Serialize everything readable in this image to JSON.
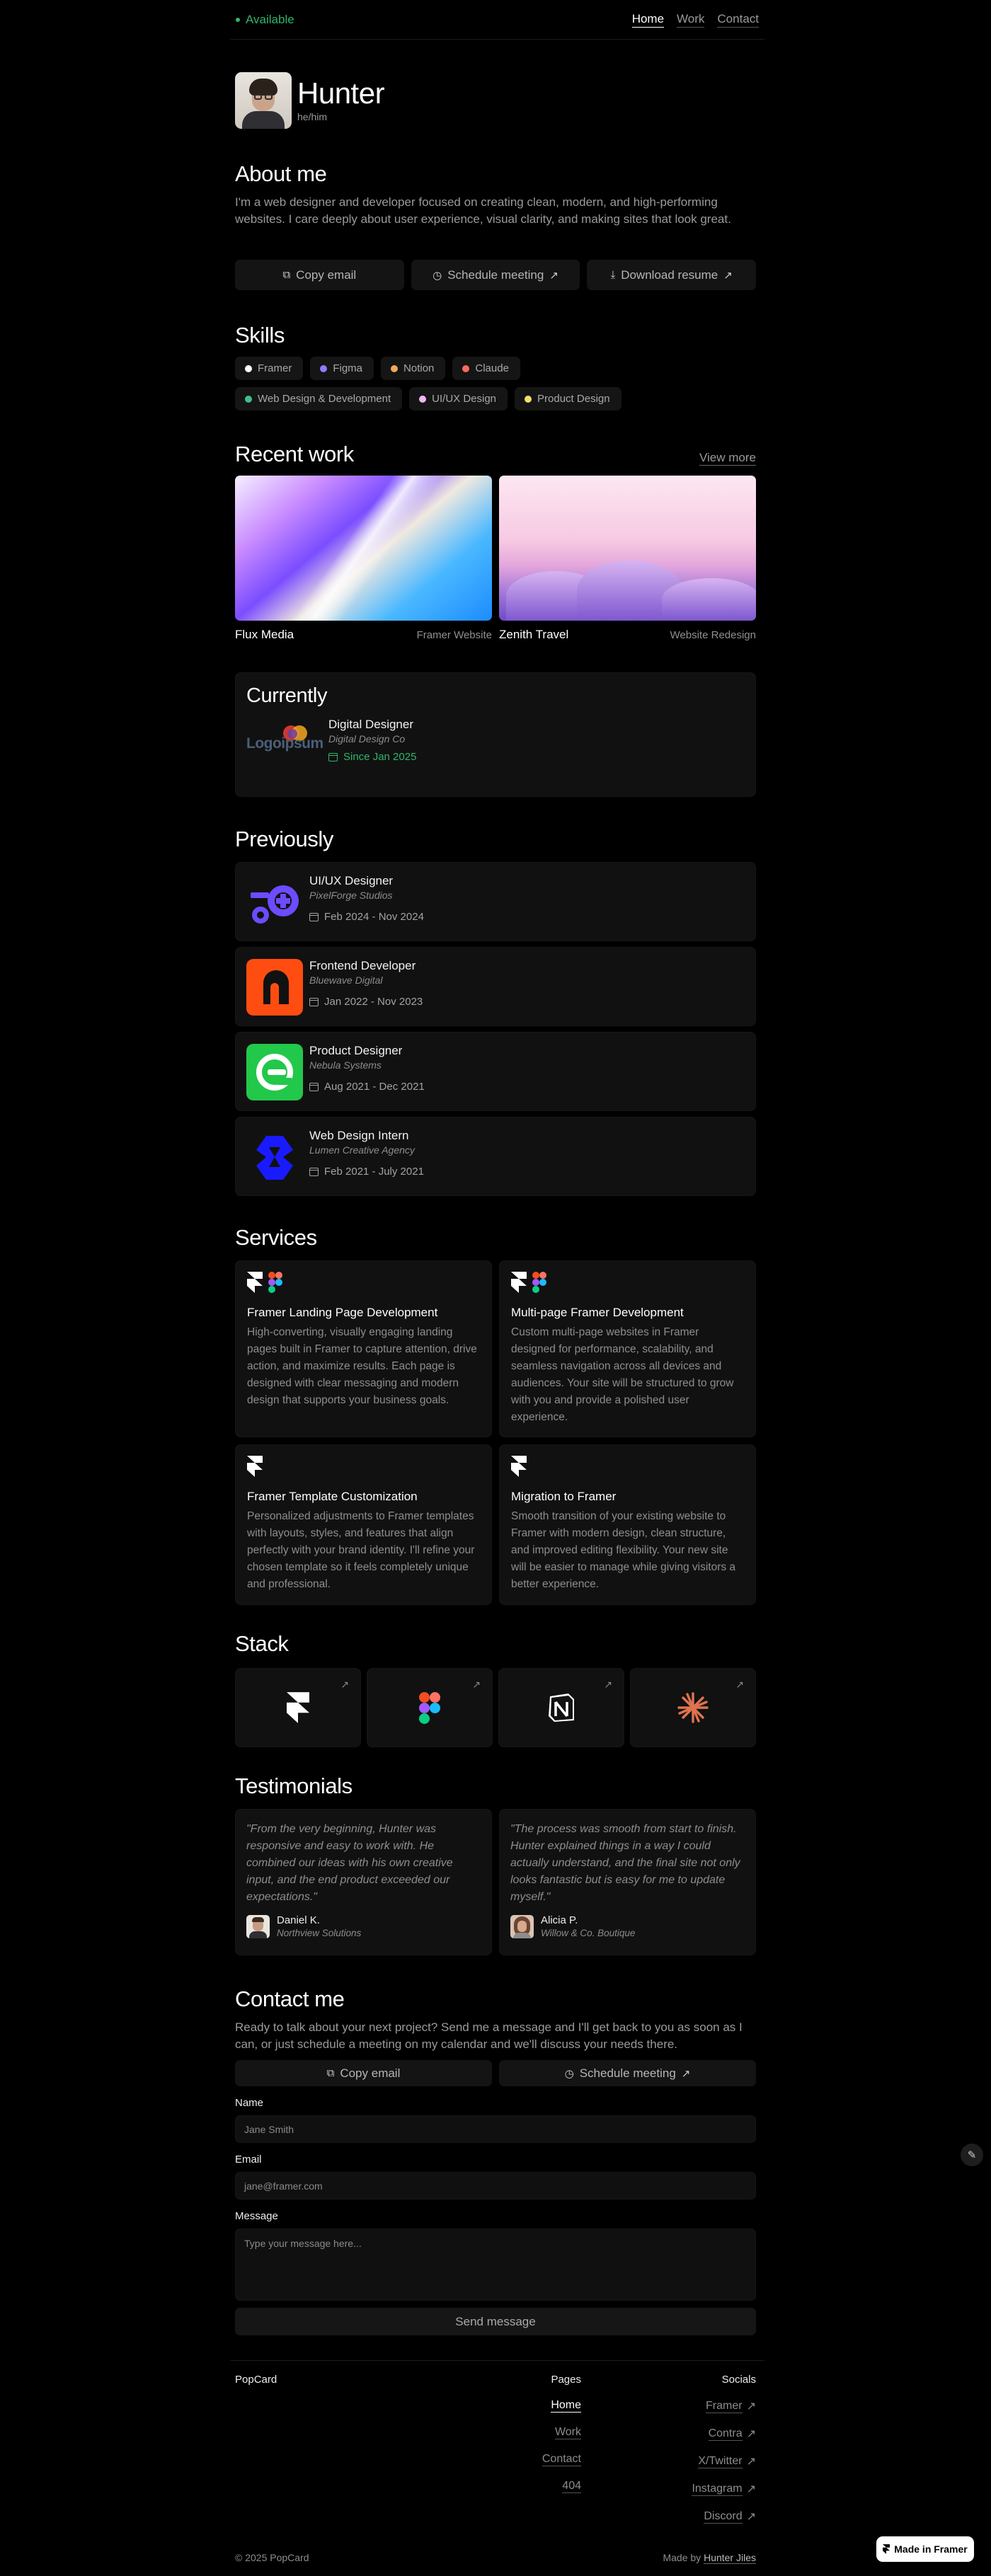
{
  "nav": {
    "status": "Available",
    "links": [
      "Home",
      "Work",
      "Contact"
    ]
  },
  "profile": {
    "name": "Hunter",
    "pronouns": "he/him"
  },
  "about": {
    "title": "About me",
    "text": "I'm a web designer and developer focused on creating clean, modern, and high-performing websites. I care deeply about user experience, visual clarity, and making sites that look great."
  },
  "actions": {
    "copy_email": "Copy email",
    "schedule": "Schedule meeting",
    "resume": "Download resume"
  },
  "skills": {
    "title": "Skills",
    "items": [
      {
        "label": "Framer",
        "color": "#ffffff"
      },
      {
        "label": "Figma",
        "color": "#8f7cff"
      },
      {
        "label": "Notion",
        "color": "#f5a65b"
      },
      {
        "label": "Claude",
        "color": "#ff6b5a"
      },
      {
        "label": "Web Design & Development",
        "color": "#3fbf8a"
      },
      {
        "label": "UI/UX Design",
        "color": "#f0b6f5"
      },
      {
        "label": "Product Design",
        "color": "#f2e06b"
      }
    ]
  },
  "recent": {
    "title": "Recent work",
    "view_more": "View more",
    "items": [
      {
        "name": "Flux Media",
        "type": "Framer Website"
      },
      {
        "name": "Zenith Travel",
        "type": "Website Redesign"
      }
    ]
  },
  "currently": {
    "title": "Currently",
    "logo_text": "Logoipsum",
    "role": "Digital Designer",
    "company": "Digital Design Co",
    "date": "Since Jan 2025"
  },
  "previously": {
    "title": "Previously",
    "items": [
      {
        "role": "UI/UX Designer",
        "company": "PixelForge Studios",
        "date": "Feb 2024 - Nov 2024"
      },
      {
        "role": "Frontend Developer",
        "company": "Bluewave Digital",
        "date": "Jan 2022 - Nov 2023"
      },
      {
        "role": "Product Designer",
        "company": "Nebula Systems",
        "date": "Aug 2021 - Dec 2021"
      },
      {
        "role": "Web Design Intern",
        "company": "Lumen Creative Agency",
        "date": "Feb 2021 - July 2021"
      }
    ]
  },
  "services": {
    "title": "Services",
    "items": [
      {
        "title": "Framer Landing Page Development",
        "desc": "High-converting, visually engaging landing pages built in Framer to capture attention, drive action, and maximize results. Each page is designed with clear messaging and modern design that supports your business goals."
      },
      {
        "title": "Multi-page Framer Development",
        "desc": "Custom multi-page websites in Framer designed for performance, scalability, and seamless navigation across all devices and audiences. Your site will be structured to grow with you and provide a polished user experience."
      },
      {
        "title": "Framer Template Customization",
        "desc": "Personalized adjustments to Framer templates with layouts, styles, and features that align perfectly with your brand identity. I'll refine your chosen template so it feels completely unique and professional."
      },
      {
        "title": "Migration to Framer",
        "desc": "Smooth transition of your existing website to Framer with modern design, clean structure, and improved editing flexibility. Your new site will be easier to manage while giving visitors a better experience."
      }
    ]
  },
  "stack": {
    "title": "Stack",
    "items": [
      "framer-icon",
      "figma-icon",
      "notion-icon",
      "claude-icon"
    ]
  },
  "testimonials": {
    "title": "Testimonials",
    "items": [
      {
        "quote": "\"From the very beginning, Hunter was responsive and easy to work with. He combined our ideas with his own creative input, and the end product exceeded our expectations.\"",
        "name": "Daniel K.",
        "company": "Northview Solutions"
      },
      {
        "quote": "\"The process was smooth from start to finish. Hunter explained things in a way I could actually understand, and the final site not only looks fantastic but is easy for me to update myself.\"",
        "name": "Alicia P.",
        "company": "Willow & Co. Boutique"
      }
    ]
  },
  "contact": {
    "title": "Contact me",
    "lead": "Ready to talk about your next project? Send me a message and I'll get back to you as soon as I can, or just schedule a meeting on my calendar and we'll discuss your needs there.",
    "copy_email": "Copy email",
    "schedule": "Schedule meeting",
    "name_label": "Name",
    "name_placeholder": "Jane Smith",
    "email_label": "Email",
    "email_placeholder": "jane@framer.com",
    "message_label": "Message",
    "message_placeholder": "Type your message here...",
    "send": "Send message"
  },
  "footer": {
    "brand": "PopCard",
    "pages_title": "Pages",
    "pages": [
      "Home",
      "Work",
      "Contact",
      "404"
    ],
    "socials_title": "Socials",
    "socials": [
      "Framer",
      "Contra",
      "X/Twitter",
      "Instagram",
      "Discord"
    ],
    "copyright": "© 2025 PopCard",
    "made_by_prefix": "Made by",
    "made_by_name": "Hunter Jiles"
  },
  "badge": {
    "made_in": "Made in Framer"
  }
}
